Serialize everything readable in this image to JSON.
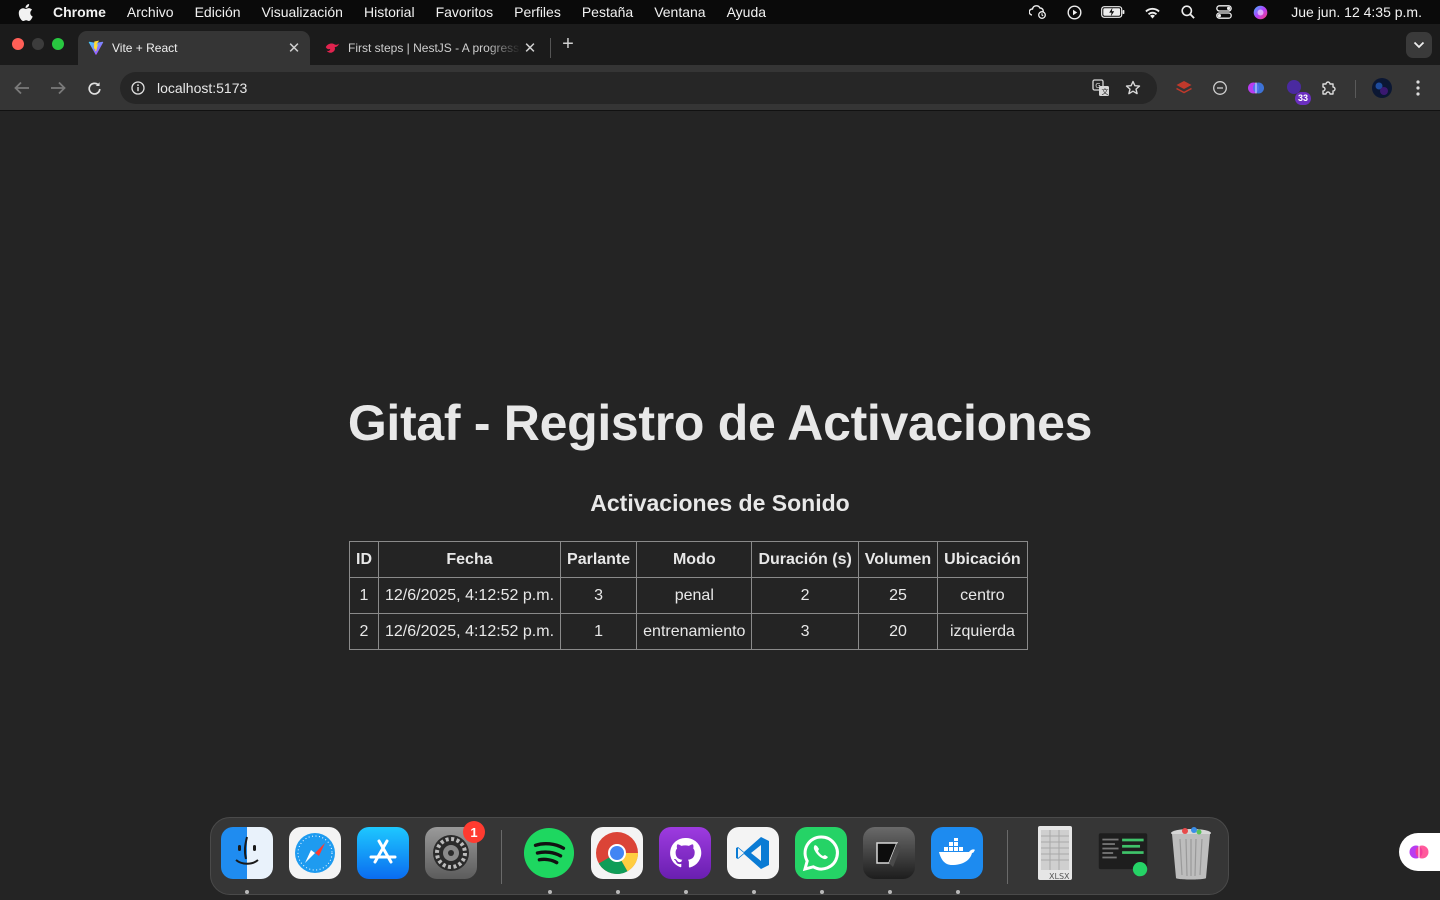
{
  "menubar": {
    "app_name": "Chrome",
    "items": [
      "Archivo",
      "Edición",
      "Visualización",
      "Historial",
      "Favoritos",
      "Perfiles",
      "Pestaña",
      "Ventana",
      "Ayuda"
    ],
    "clock": "Jue jun. 12  4:35 p.m."
  },
  "tabs": [
    {
      "title": "Vite + React",
      "favicon": "vite-icon",
      "active": true
    },
    {
      "title": "First steps | NestJS - A progressive",
      "favicon": "nestjs-icon",
      "active": false
    }
  ],
  "toolbar": {
    "url": "localhost:5173",
    "extension_badge": "33"
  },
  "page": {
    "title": "Gitaf - Registro de Activaciones",
    "section_title": "Activaciones de Sonido",
    "table": {
      "headers": [
        "ID",
        "Fecha",
        "Parlante",
        "Modo",
        "Duración (s)",
        "Volumen",
        "Ubicación"
      ],
      "rows": [
        [
          "1",
          "12/6/2025, 4:12:52 p.m.",
          "3",
          "penal",
          "2",
          "25",
          "centro"
        ],
        [
          "2",
          "12/6/2025, 4:12:52 p.m.",
          "1",
          "entrenamiento",
          "3",
          "20",
          "izquierda"
        ]
      ]
    }
  },
  "dock": {
    "apps": [
      "finder-icon",
      "safari-icon",
      "app-store-icon",
      "system-settings-icon",
      "spotify-icon",
      "chrome-icon",
      "github-desktop-icon",
      "vscode-icon",
      "whatsapp-icon",
      "cursor-icon",
      "docker-icon",
      "xlsx-file-icon",
      "screen-recording-icon",
      "trash-icon"
    ],
    "settings_badge": "1",
    "xlsx_label": "XLSX"
  },
  "colors": {
    "background": "#242424",
    "text": "#e8e8e8",
    "table_border": "#8a8a8a",
    "tab_active": "#353535"
  }
}
